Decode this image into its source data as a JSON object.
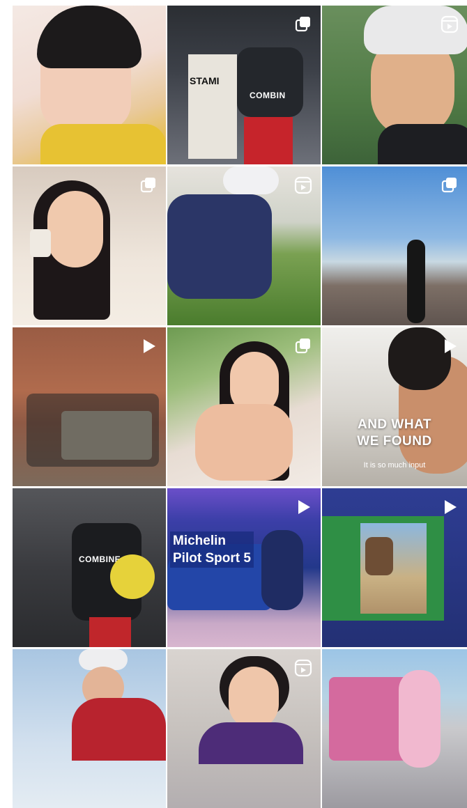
{
  "posts": [
    {
      "id": "post-1",
      "kind": "photo",
      "badge": null
    },
    {
      "id": "post-2",
      "kind": "carousel",
      "badge": "carousel-icon",
      "sign_text": "STAMI",
      "shirt_text": "COMBIN"
    },
    {
      "id": "post-3",
      "kind": "reel",
      "badge": "reels-icon"
    },
    {
      "id": "post-4",
      "kind": "carousel",
      "badge": "carousel-icon"
    },
    {
      "id": "post-5",
      "kind": "reel",
      "badge": "reels-icon"
    },
    {
      "id": "post-6",
      "kind": "carousel",
      "badge": "carousel-icon"
    },
    {
      "id": "post-7",
      "kind": "video",
      "badge": "play-icon"
    },
    {
      "id": "post-8",
      "kind": "carousel",
      "badge": "carousel-icon"
    },
    {
      "id": "post-9",
      "kind": "video",
      "badge": "play-icon",
      "overlay_title_1": "AND WHAT",
      "overlay_title_2": "WE FOUND",
      "overlay_sub": "It is so much input"
    },
    {
      "id": "post-10",
      "kind": "photo",
      "badge": null,
      "shirt_text": "COMBINE"
    },
    {
      "id": "post-11",
      "kind": "video",
      "badge": "play-icon",
      "overlay_line_1": "Michelin",
      "overlay_line_2": "Pilot Sport 5"
    },
    {
      "id": "post-12",
      "kind": "video",
      "badge": "play-icon"
    },
    {
      "id": "post-13",
      "kind": "photo",
      "badge": null
    },
    {
      "id": "post-14",
      "kind": "reel",
      "badge": "reels-icon"
    },
    {
      "id": "post-15",
      "kind": "photo",
      "badge": null
    }
  ],
  "colors": {
    "background": "#ffffff",
    "badge": "#ffffff"
  }
}
